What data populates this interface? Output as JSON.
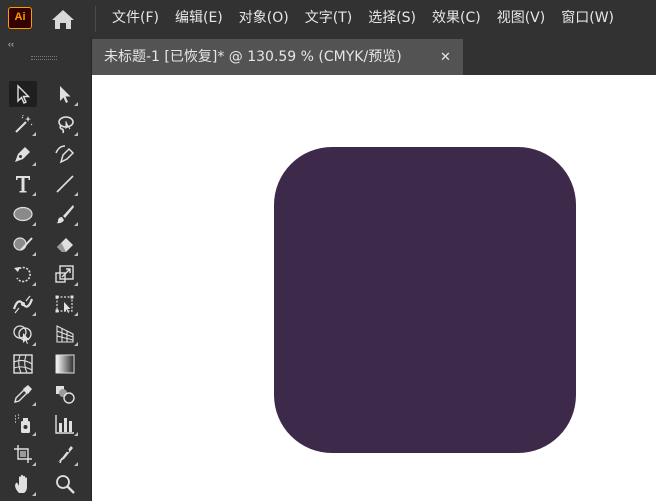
{
  "app": {
    "logo_text": "Ai",
    "logo_color": "#ff9a00",
    "logo_bg": "#330000"
  },
  "menu": {
    "items": [
      "文件(F)",
      "编辑(E)",
      "对象(O)",
      "文字(T)",
      "选择(S)",
      "效果(C)",
      "视图(V)",
      "窗口(W)"
    ]
  },
  "toolbar": {
    "collapse_glyph": "‹‹",
    "tools": [
      {
        "name": "selection-tool-icon",
        "active": true
      },
      {
        "name": "direct-selection-tool-icon"
      },
      {
        "name": "magic-wand-tool-icon"
      },
      {
        "name": "lasso-tool-icon"
      },
      {
        "name": "pen-tool-icon"
      },
      {
        "name": "curvature-tool-icon"
      },
      {
        "name": "type-tool-icon"
      },
      {
        "name": "line-segment-tool-icon"
      },
      {
        "name": "ellipse-tool-icon"
      },
      {
        "name": "paintbrush-tool-icon"
      },
      {
        "name": "shaper-tool-icon"
      },
      {
        "name": "eraser-tool-icon"
      },
      {
        "name": "rotate-tool-icon"
      },
      {
        "name": "scale-tool-icon"
      },
      {
        "name": "width-tool-icon"
      },
      {
        "name": "free-transform-tool-icon"
      },
      {
        "name": "shape-builder-tool-icon"
      },
      {
        "name": "perspective-grid-tool-icon"
      },
      {
        "name": "mesh-tool-icon"
      },
      {
        "name": "gradient-tool-icon"
      },
      {
        "name": "eyedropper-tool-icon"
      },
      {
        "name": "blend-tool-icon"
      },
      {
        "name": "symbol-sprayer-tool-icon"
      },
      {
        "name": "column-graph-tool-icon"
      },
      {
        "name": "artboard-tool-icon"
      },
      {
        "name": "slice-tool-icon"
      },
      {
        "name": "hand-tool-icon"
      },
      {
        "name": "zoom-tool-icon"
      }
    ]
  },
  "document": {
    "tab_title": "未标题-1 [已恢复]* @ 130.59 % (CMYK/预览)",
    "close_glyph": "✕",
    "shape_color": "#3d2a4b",
    "canvas_color": "#ffffff"
  }
}
